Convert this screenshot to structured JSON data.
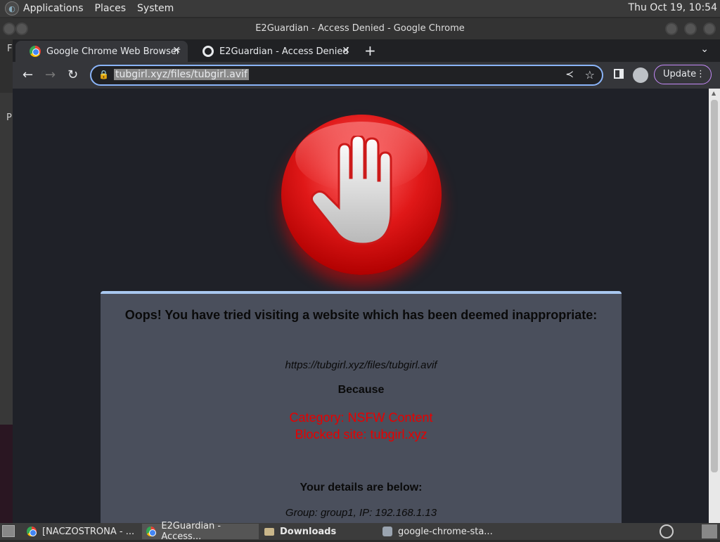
{
  "top_panel": {
    "menus": [
      "Applications",
      "Places",
      "System"
    ],
    "clock": "Thu Oct 19, 10:54"
  },
  "window": {
    "title": "E2Guardian - Access Denied - Google Chrome"
  },
  "tabs": [
    {
      "label": "Google Chrome Web Browser",
      "icon": "chrome-icon",
      "active": true
    },
    {
      "label": "E2Guardian - Access Denied",
      "icon": "globe-icon",
      "active": false
    }
  ],
  "toolbar": {
    "url": "tubgirl.xyz/files/tubgirl.avif",
    "update_label": "Update"
  },
  "page": {
    "heading": "Oops! You have tried visiting a website which has been deemed inappropriate:",
    "blocked_url": "https://tubgirl.xyz/files/tubgirl.avif",
    "because": "Because",
    "category": "Category: NSFW Content",
    "blocked_site": "Blocked site: tubgirl.xyz",
    "details_heading": "Your details are below:",
    "details": "Group: group1, IP: 192.168.1.13"
  },
  "taskbar": {
    "items": [
      {
        "label": "[NACZOSTRONA - ..."
      },
      {
        "label": "E2Guardian - Access..."
      },
      {
        "label": "Downloads"
      },
      {
        "label": "google-chrome-sta..."
      }
    ]
  }
}
